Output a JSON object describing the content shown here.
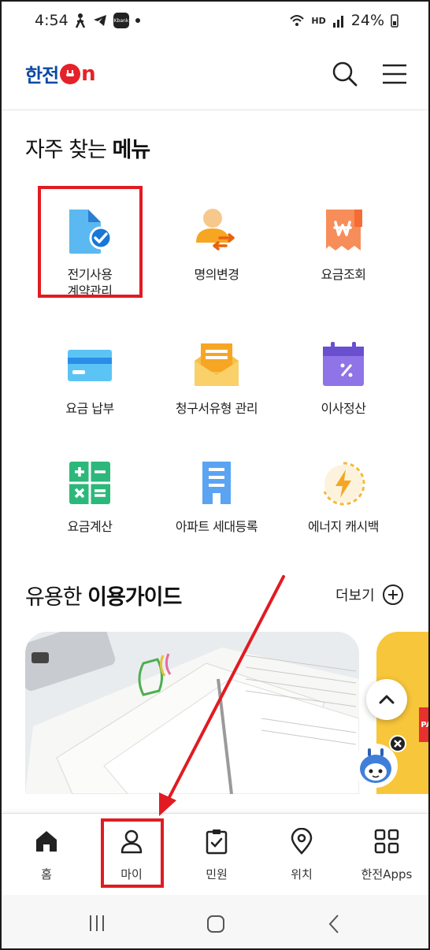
{
  "status_bar": {
    "time": "4:54",
    "battery": "24%",
    "network": "HD"
  },
  "header": {
    "logo_text": "한전",
    "logo_suffix": "n",
    "brand_blue": "#0b4aa3",
    "brand_red": "#e52229"
  },
  "favorites": {
    "title_regular": "자주 찾는 ",
    "title_bold": "메뉴",
    "items": [
      {
        "label_line1": "전기사용",
        "label_line2": "계약관리",
        "icon": "contract-document-icon"
      },
      {
        "label_line1": "명의변경",
        "label_line2": "",
        "icon": "person-change-icon"
      },
      {
        "label_line1": "요금조회",
        "label_line2": "",
        "icon": "won-receipt-icon"
      },
      {
        "label_line1": "요금 납부",
        "label_line2": "",
        "icon": "credit-card-icon"
      },
      {
        "label_line1": "청구서유형 관리",
        "label_line2": "",
        "icon": "envelope-icon"
      },
      {
        "label_line1": "이사정산",
        "label_line2": "",
        "icon": "calendar-percent-icon"
      },
      {
        "label_line1": "요금계산",
        "label_line2": "",
        "icon": "calculator-icon"
      },
      {
        "label_line1": "아파트 세대등록",
        "label_line2": "",
        "icon": "building-icon"
      },
      {
        "label_line1": "에너지 캐시백",
        "label_line2": "",
        "icon": "lightning-cashback-icon"
      }
    ]
  },
  "guide": {
    "title_regular": "유용한 ",
    "title_bold": "이용가이드",
    "more_label": "더보기",
    "side_badge": "PAS"
  },
  "bottom_nav": {
    "items": [
      {
        "label": "홈",
        "icon": "home-icon"
      },
      {
        "label": "마이",
        "icon": "person-icon"
      },
      {
        "label": "민원",
        "icon": "clipboard-check-icon"
      },
      {
        "label": "위치",
        "icon": "location-pin-icon"
      },
      {
        "label": "한전Apps",
        "icon": "apps-grid-icon"
      }
    ]
  },
  "colors": {
    "highlight_red": "#e11b22",
    "accent_blue": "#2a8ee8",
    "accent_orange": "#f6a623"
  }
}
